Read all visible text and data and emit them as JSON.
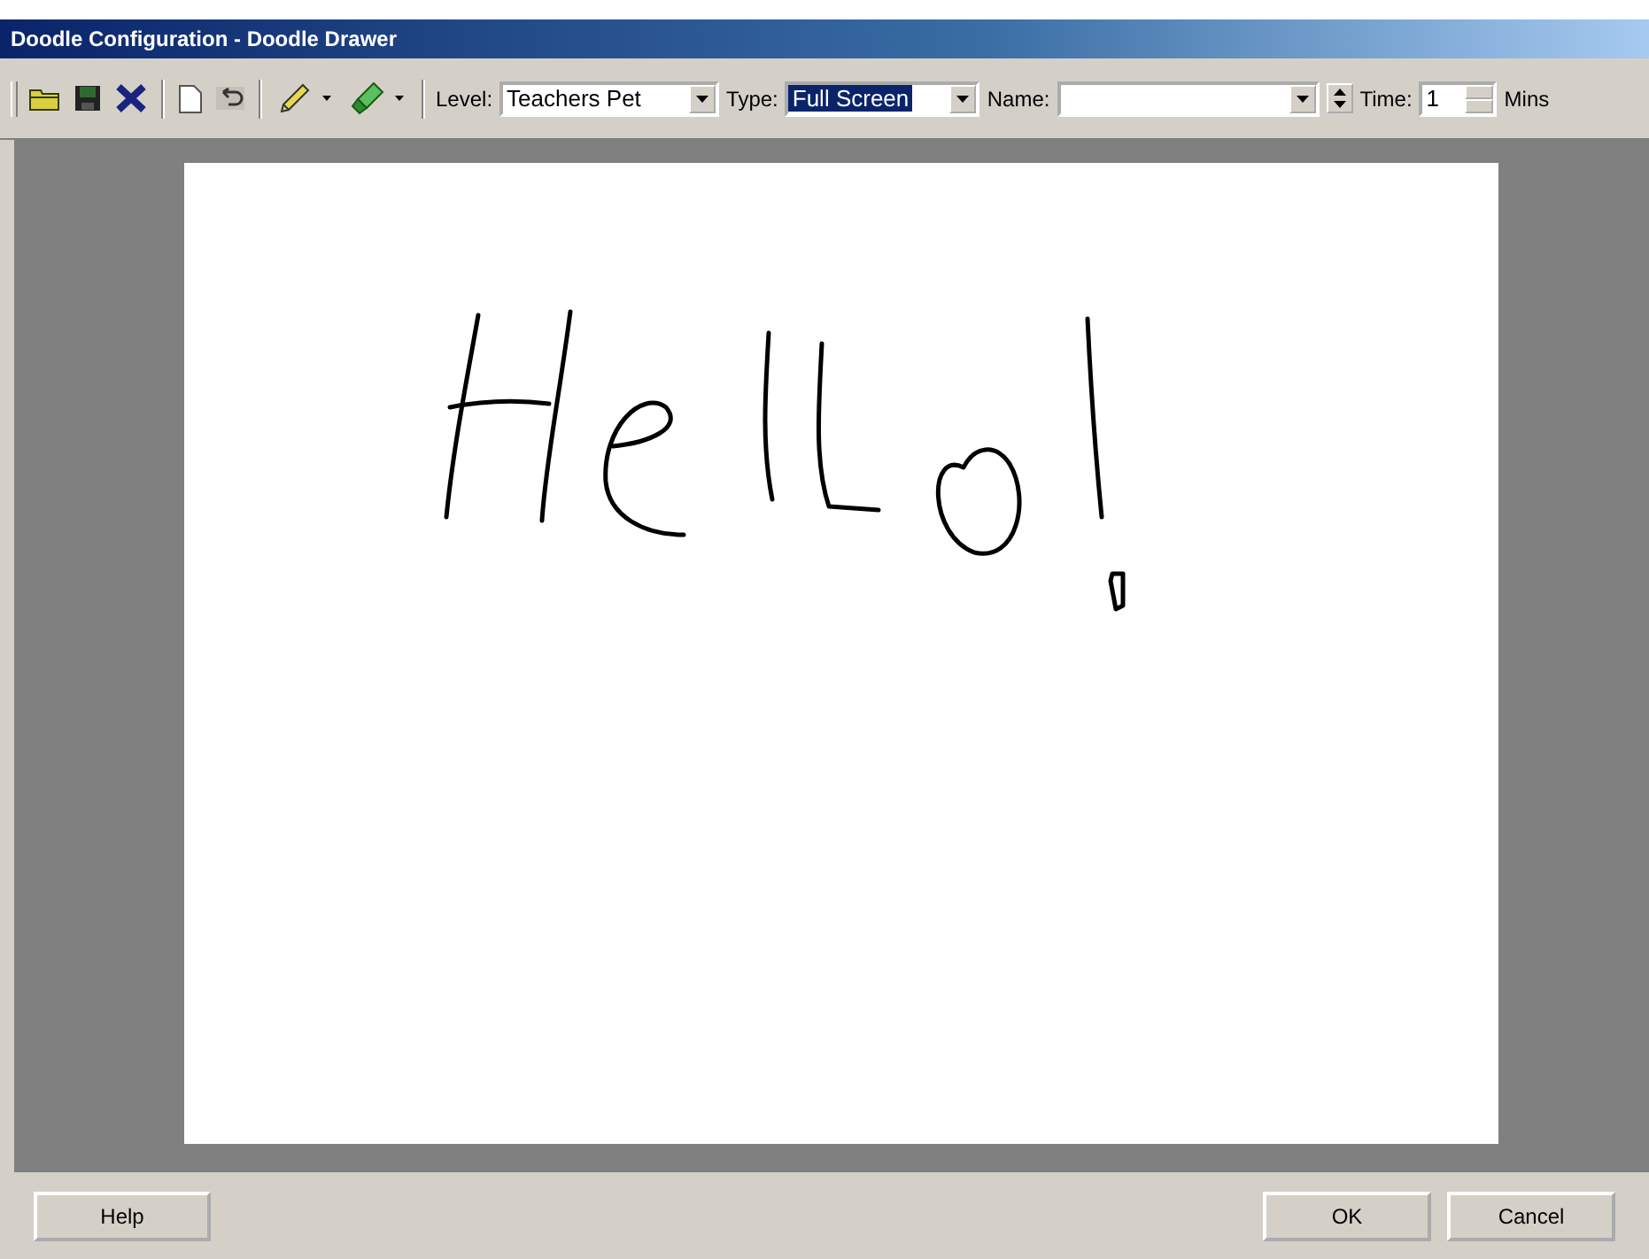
{
  "window": {
    "title": "Doodle Configuration - Doodle Drawer"
  },
  "toolbar": {
    "tools": [
      {
        "kind": "open"
      },
      {
        "kind": "save"
      },
      {
        "kind": "delete"
      },
      {
        "kind": "sep"
      },
      {
        "kind": "new"
      },
      {
        "kind": "undo",
        "disabled": true
      },
      {
        "kind": "sep"
      },
      {
        "kind": "pencil",
        "dropdown": true
      },
      {
        "kind": "marker",
        "dropdown": true
      },
      {
        "kind": "sep"
      }
    ],
    "level": {
      "label": "Level:",
      "value": "Teachers Pet"
    },
    "type": {
      "label": "Type:",
      "value": "Full Screen",
      "selected": true
    },
    "name": {
      "label": "Name:"
    },
    "time": {
      "label": "Time:",
      "value": "1",
      "unit": "Mins"
    }
  },
  "buttons": [
    {
      "kind": "help",
      "label": "Help"
    },
    {
      "kind": "ok",
      "label": "OK"
    },
    {
      "kind": "cancel",
      "label": "Cancel"
    }
  ]
}
